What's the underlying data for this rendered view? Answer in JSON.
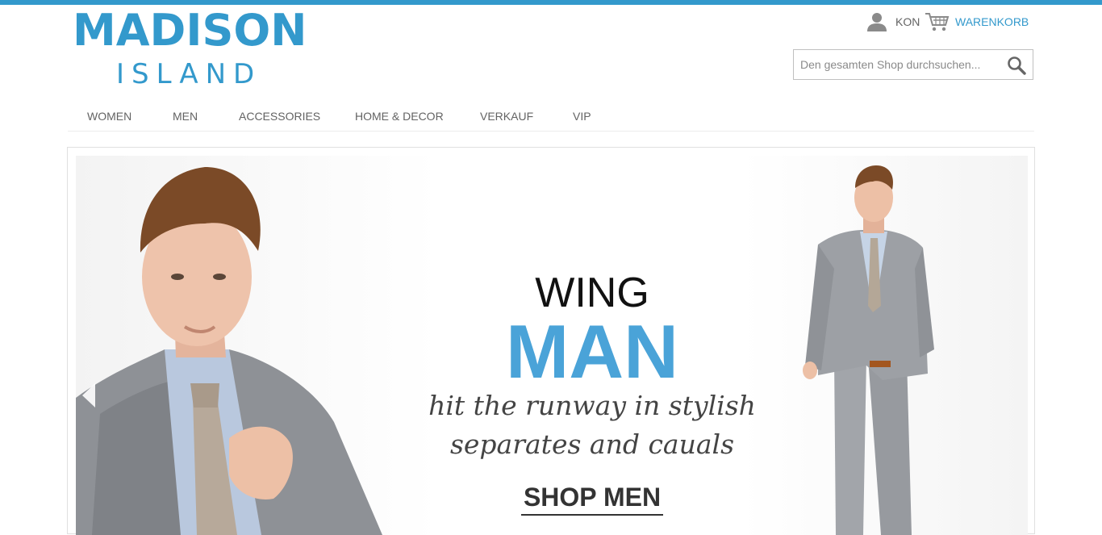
{
  "header": {
    "logo_main": "MADISON",
    "logo_sub": "ISLAND",
    "account_label": "KON",
    "cart_label": "WARENKORB",
    "search": {
      "placeholder": "Den gesamten Shop durchsuchen..."
    }
  },
  "nav": {
    "items": [
      {
        "label": "WOMEN"
      },
      {
        "label": "MEN"
      },
      {
        "label": "ACCESSORIES"
      },
      {
        "label": "HOME & DECOR"
      },
      {
        "label": "VERKAUF"
      },
      {
        "label": "VIP"
      }
    ]
  },
  "hero": {
    "line1": "WING",
    "line2": "MAN",
    "tagline_1": "hit the runway in stylish",
    "tagline_2": "separates and cauals",
    "cta": "SHOP MEN"
  },
  "icons": {
    "account": "person-icon",
    "cart": "shopping-cart-icon",
    "search": "magnifier-icon",
    "prev": "chevron-left-icon"
  },
  "colors": {
    "brand": "#3399cc",
    "headline_accent": "#4aa3d8",
    "text": "#636363"
  }
}
